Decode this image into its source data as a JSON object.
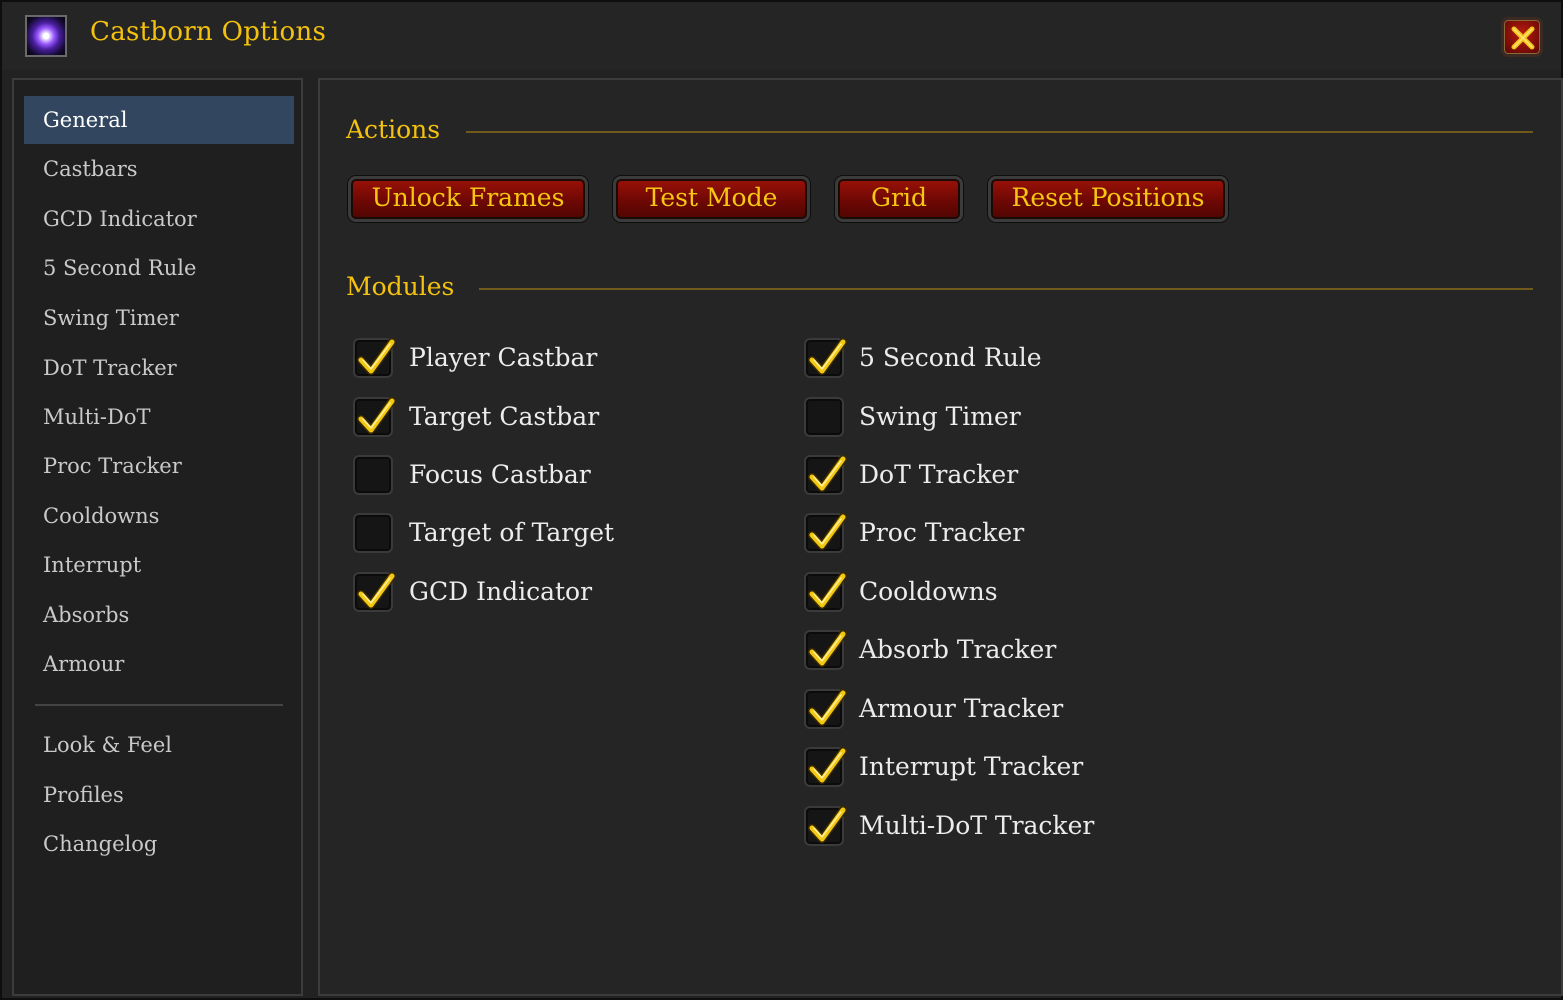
{
  "window": {
    "title": "Castborn Options",
    "app_icon": "spell-star-icon",
    "close_icon": "close-x-icon"
  },
  "sidebar": {
    "items": [
      {
        "label": "General",
        "active": true
      },
      {
        "label": "Castbars"
      },
      {
        "label": "GCD Indicator"
      },
      {
        "label": "5 Second Rule"
      },
      {
        "label": "Swing Timer"
      },
      {
        "label": "DoT Tracker"
      },
      {
        "label": "Multi-DoT"
      },
      {
        "label": "Proc Tracker"
      },
      {
        "label": "Cooldowns"
      },
      {
        "label": "Interrupt"
      },
      {
        "label": "Absorbs"
      },
      {
        "label": "Armour"
      }
    ],
    "footer_items": [
      {
        "label": "Look & Feel"
      },
      {
        "label": "Profiles"
      },
      {
        "label": "Changelog"
      }
    ]
  },
  "actions": {
    "title": "Actions",
    "buttons": [
      {
        "label": "Unlock Frames"
      },
      {
        "label": "Test Mode"
      },
      {
        "label": "Grid"
      },
      {
        "label": "Reset Positions"
      }
    ]
  },
  "modules": {
    "title": "Modules",
    "left": [
      {
        "label": "Player Castbar",
        "checked": true
      },
      {
        "label": "Target Castbar",
        "checked": true
      },
      {
        "label": "Focus Castbar",
        "checked": false
      },
      {
        "label": "Target of Target",
        "checked": false
      },
      {
        "label": "GCD Indicator",
        "checked": true
      }
    ],
    "right": [
      {
        "label": "5 Second Rule",
        "checked": true
      },
      {
        "label": "Swing Timer",
        "checked": false
      },
      {
        "label": "DoT Tracker",
        "checked": true
      },
      {
        "label": "Proc Tracker",
        "checked": true
      },
      {
        "label": "Cooldowns",
        "checked": true
      },
      {
        "label": "Absorb Tracker",
        "checked": true
      },
      {
        "label": "Armour Tracker",
        "checked": true
      },
      {
        "label": "Interrupt Tracker",
        "checked": true
      },
      {
        "label": "Multi-DoT Tracker",
        "checked": true
      }
    ]
  },
  "colors": {
    "accent_gold": "#f4c20e",
    "button_red": "#7a0a05",
    "active_nav": "#32465f"
  }
}
